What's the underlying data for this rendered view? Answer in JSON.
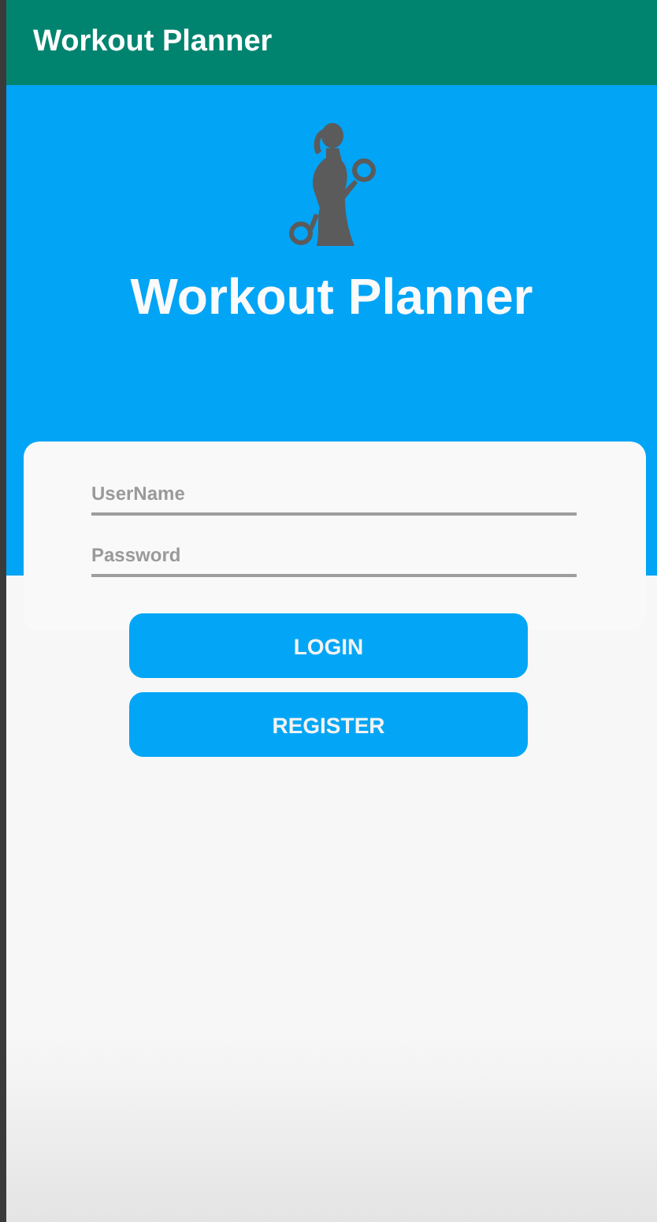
{
  "app_bar": {
    "title": "Workout Planner"
  },
  "hero": {
    "title": "Workout Planner"
  },
  "form": {
    "fields": [
      {
        "placeholder": "UserName"
      },
      {
        "placeholder": "Password"
      }
    ],
    "buttons": [
      "LOGIN",
      "REGISTER"
    ]
  }
}
